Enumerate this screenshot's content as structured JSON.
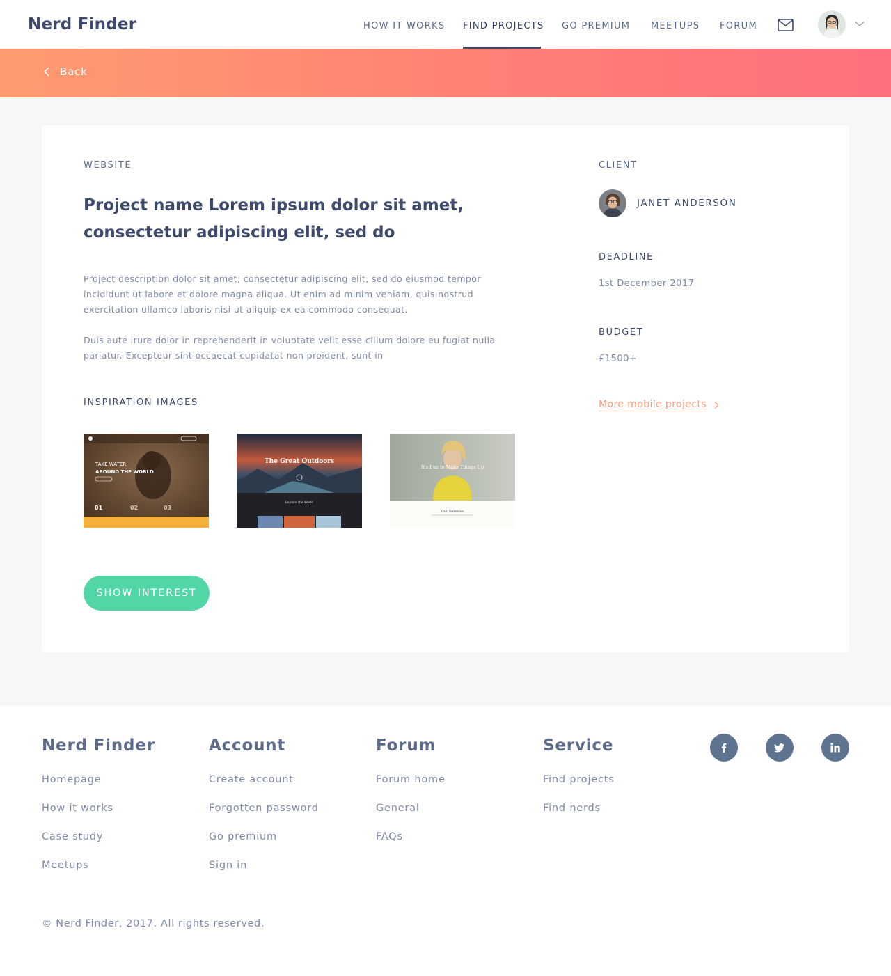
{
  "header": {
    "logo": "Nerd Finder",
    "nav": [
      {
        "label": "HOW IT WORKS",
        "active": false
      },
      {
        "label": "FIND PROJECTS",
        "active": true
      },
      {
        "label": "GO PREMIUM",
        "active": false
      },
      {
        "label": "MEETUPS",
        "active": false
      },
      {
        "label": "FORUM",
        "active": false
      }
    ],
    "icons": {
      "mail": "mail-icon",
      "avatar": "user-avatar",
      "menu": "chevron-down-icon"
    }
  },
  "banner": {
    "back_label": "Back",
    "gradient": [
      "#ff9b70",
      "#ff6f7c"
    ]
  },
  "project": {
    "category": "WEBSITE",
    "title": "Project name Lorem ipsum dolor sit amet, consectetur adipiscing elit, sed do",
    "description_1": "Project description dolor sit amet, consectetur adipiscing elit, sed do eiusmod tempor incididunt ut labore et dolore magna aliqua. Ut enim ad minim veniam, quis nostrud exercitation ullamco laboris nisi ut aliquip ex ea commodo consequat.",
    "description_2": "Duis aute irure dolor in reprehenderit in voluptate velit esse cillum dolore eu fugiat nulla pariatur. Excepteur sint occaecat cupidatat non proident, sunt in",
    "inspiration_label": "INSPIRATION IMAGES",
    "inspiration_images": [
      {
        "thumb_title": "TAKE WATER",
        "thumb_subtitle": "AROUND THE WORLD",
        "steps": [
          "01",
          "02",
          "03"
        ]
      },
      {
        "thumb_title": "The Great Outdoors",
        "thumb_subtitle": "Explore the World"
      },
      {
        "thumb_title": "It's Fun to Make Things Up",
        "thumb_subtitle": "Our Services"
      }
    ],
    "cta_label": "SHOW INTEREST",
    "cta_color": "#52d6a5"
  },
  "sidebar": {
    "client_label": "CLIENT",
    "client_name": "JANET ANDERSON",
    "deadline_label": "DEADLINE",
    "deadline_value": "1st December 2017",
    "budget_label": "BUDGET",
    "budget_value": "£1500+",
    "more_link": "More mobile projects",
    "link_color": "#ff9b7a"
  },
  "footer": {
    "columns": [
      {
        "title": "Nerd Finder",
        "links": [
          "Homepage",
          "How it works",
          "Case study",
          "Meetups"
        ]
      },
      {
        "title": "Account",
        "links": [
          "Create account",
          "Forgotten password",
          "Go premium",
          "Sign in"
        ]
      },
      {
        "title": "Forum",
        "links": [
          "Forum home",
          "General",
          "FAQs"
        ]
      },
      {
        "title": "Service",
        "links": [
          "Find projects",
          "Find nerds"
        ]
      }
    ],
    "social": [
      "facebook-icon",
      "twitter-icon",
      "linkedin-icon"
    ],
    "copyright": "© Nerd Finder, 2017. All rights reserved."
  }
}
